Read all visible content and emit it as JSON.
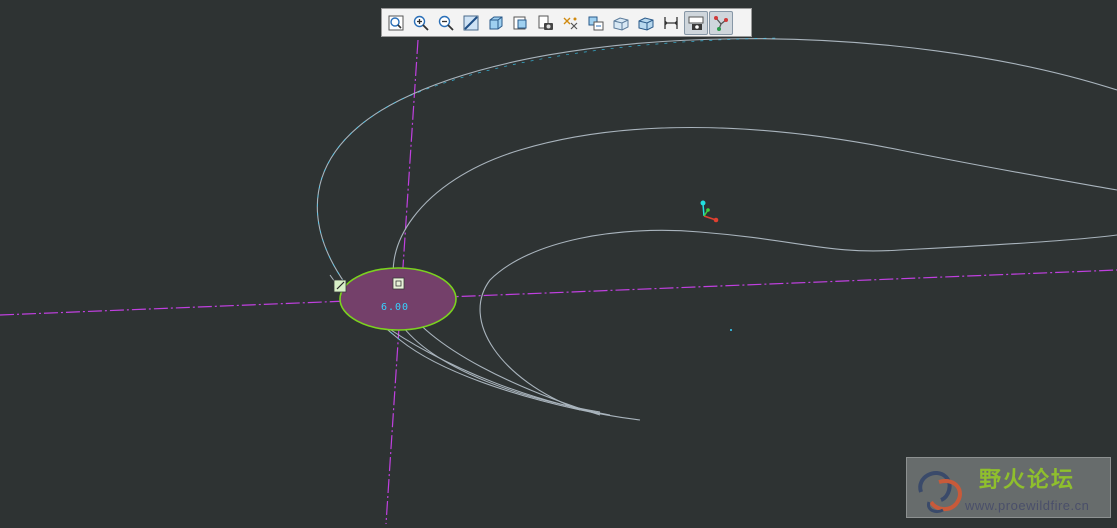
{
  "colors": {
    "background": "#2e3333",
    "datum_axis": "#c040e0",
    "curve": "#a9b4bd",
    "section_fill": "#74406a",
    "section_outline": "#7bd21f",
    "dimension_text": "#37d2ff"
  },
  "toolbar": {
    "buttons": [
      {
        "name": "refit-icon",
        "active": false
      },
      {
        "name": "zoom-in-icon",
        "active": false
      },
      {
        "name": "zoom-out-icon",
        "active": false
      },
      {
        "name": "repaint-icon",
        "active": false
      },
      {
        "name": "display-style-icon",
        "active": false
      },
      {
        "name": "saved-orientations-icon",
        "active": false
      },
      {
        "name": "view-manager-icon",
        "active": false
      },
      {
        "name": "datum-display-icon",
        "active": false
      },
      {
        "name": "annotation-display-icon",
        "active": false
      },
      {
        "name": "spin-center-icon",
        "active": false
      },
      {
        "name": "section-view-icon",
        "active": false
      },
      {
        "name": "sketch-setup-icon",
        "active": false
      },
      {
        "name": "sketch-view-icon",
        "active": true
      },
      {
        "name": "trajectory-icon",
        "active": true
      }
    ]
  },
  "canvas": {
    "dimension_value": "6.00"
  },
  "watermark": {
    "title": "野火论坛",
    "url": "www.proewildfire.cn"
  }
}
